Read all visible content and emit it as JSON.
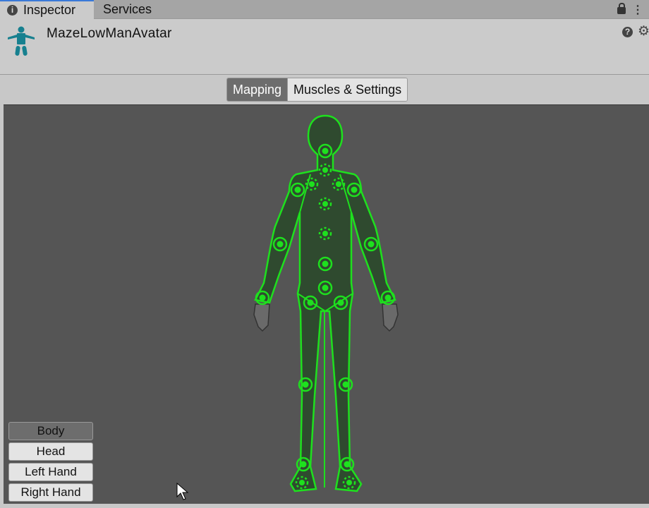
{
  "tabs": [
    {
      "label": "Inspector",
      "icon": "info-icon"
    },
    {
      "label": "Services"
    }
  ],
  "header": {
    "title": "MazeLowManAvatar",
    "icon": "avatar-icon",
    "accent": "#17808f"
  },
  "mode_tabs": [
    {
      "label": "Mapping",
      "selected": true
    },
    {
      "label": "Muscles & Settings",
      "selected": false
    }
  ],
  "view_buttons": [
    {
      "label": "Body",
      "selected": true
    },
    {
      "label": "Head"
    },
    {
      "label": "Left Hand"
    },
    {
      "label": "Right Hand"
    }
  ],
  "colors": {
    "bone_ok": "#1ee01e",
    "body_fill": "#2f4a2f",
    "viewport": "#555555"
  }
}
